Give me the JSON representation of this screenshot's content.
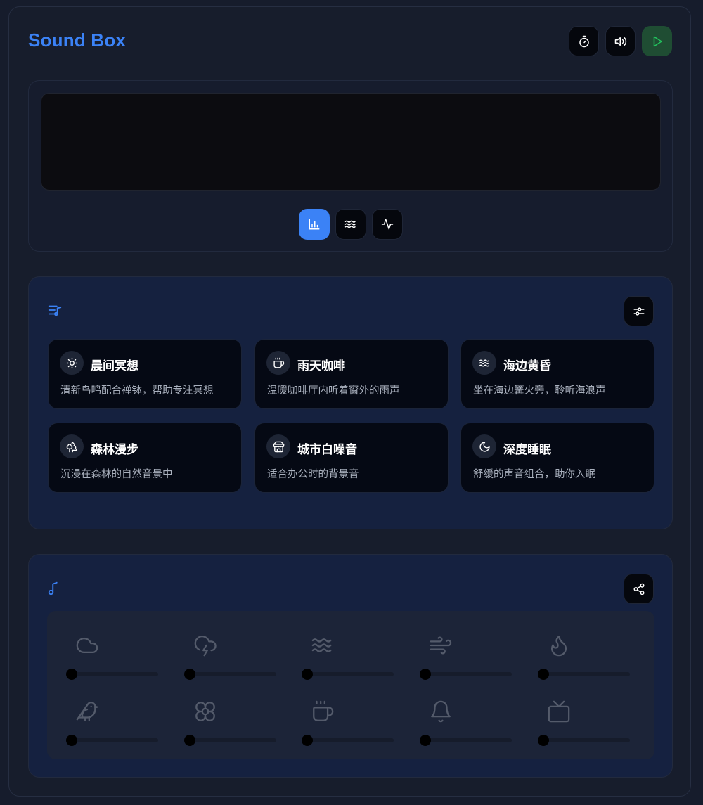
{
  "app": {
    "title": "Sound Box"
  },
  "header": {
    "buttons": [
      {
        "icon": "timer-icon"
      },
      {
        "icon": "volume-icon"
      },
      {
        "icon": "play-icon"
      }
    ]
  },
  "visualizer": {
    "modes": [
      {
        "icon": "bar-chart-icon",
        "active": true
      },
      {
        "icon": "waves-icon",
        "active": false
      },
      {
        "icon": "activity-icon",
        "active": false
      }
    ]
  },
  "scenes": {
    "header_icon": "playlist-icon",
    "settings_icon": "sliders-icon",
    "items": [
      {
        "icon": "sun-icon",
        "title": "晨间冥想",
        "desc": "清新鸟鸣配合禅钵，帮助专注冥想"
      },
      {
        "icon": "coffee-icon",
        "title": "雨天咖啡",
        "desc": "温暖咖啡厅内听着窗外的雨声"
      },
      {
        "icon": "waves-icon",
        "title": "海边黄昏",
        "desc": "坐在海边篝火旁，聆听海浪声"
      },
      {
        "icon": "trees-icon",
        "title": "森林漫步",
        "desc": "沉浸在森林的自然音景中"
      },
      {
        "icon": "store-icon",
        "title": "城市白噪音",
        "desc": "适合办公时的背景音"
      },
      {
        "icon": "moon-icon",
        "title": "深度睡眠",
        "desc": "舒缓的声音组合，助你入眠"
      }
    ]
  },
  "mixer": {
    "header_icon": "music-note-icon",
    "share_icon": "share-icon",
    "sounds": [
      {
        "icon": "cloud-icon",
        "volume": 0
      },
      {
        "icon": "cloud-lightning-icon",
        "volume": 0
      },
      {
        "icon": "waves-icon",
        "volume": 0
      },
      {
        "icon": "wind-icon",
        "volume": 0
      },
      {
        "icon": "flame-icon",
        "volume": 0
      },
      {
        "icon": "bird-icon",
        "volume": 0
      },
      {
        "icon": "flower-icon",
        "volume": 0
      },
      {
        "icon": "coffee-icon",
        "volume": 0
      },
      {
        "icon": "bell-icon",
        "volume": 0
      },
      {
        "icon": "tv-icon",
        "volume": 0
      }
    ]
  },
  "colors": {
    "accent": "#3b82f6",
    "play": "#22c55e",
    "background": "#171d2c",
    "card": "#050914"
  }
}
